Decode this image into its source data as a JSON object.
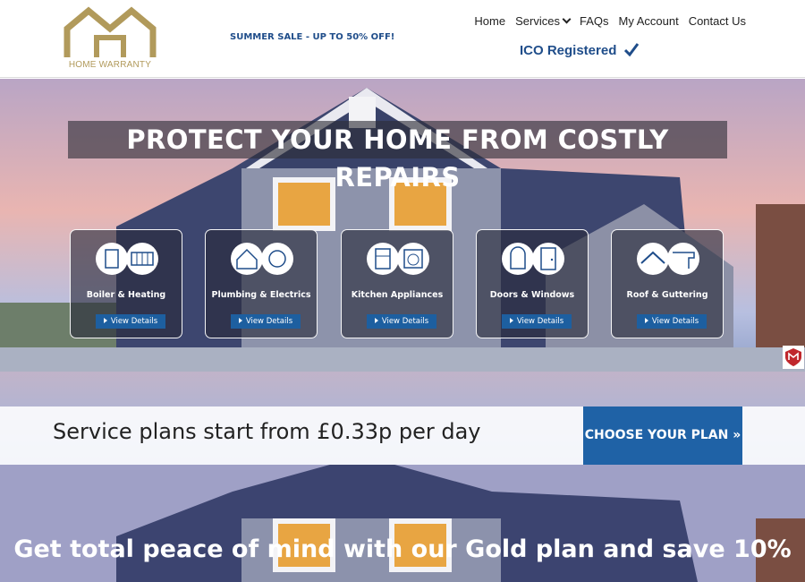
{
  "header": {
    "logo_text": "HOME WARRANTY",
    "promo": "SUMMER SALE - UP TO 50% OFF!",
    "ico": "ICO Registered"
  },
  "nav": {
    "items": [
      {
        "label": "Home"
      },
      {
        "label": "Services"
      },
      {
        "label": "FAQs"
      },
      {
        "label": "My Account"
      },
      {
        "label": "Contact Us"
      }
    ]
  },
  "hero": {
    "headline": "PROTECT YOUR HOME FROM COSTLY REPAIRS"
  },
  "services": [
    {
      "title": "Boiler & Heating",
      "button": "View Details",
      "icons": [
        "boiler-icon",
        "radiator-icon"
      ]
    },
    {
      "title": "Plumbing & Electrics",
      "button": "View Details",
      "icons": [
        "house-plug-icon",
        "fuse-icon"
      ]
    },
    {
      "title": "Kitchen Appliances",
      "button": "View Details",
      "icons": [
        "fridge-icon",
        "washing-machine-icon"
      ]
    },
    {
      "title": "Doors & Windows",
      "button": "View Details",
      "icons": [
        "window-icon",
        "door-icon"
      ]
    },
    {
      "title": "Roof & Guttering",
      "button": "View Details",
      "icons": [
        "roof-icon",
        "gutter-icon"
      ]
    }
  ],
  "plan": {
    "text": "Service plans start from £0.33p per day",
    "button": "CHOOSE YOUR PLAN »"
  },
  "gold": {
    "text": "Get total peace of mind with our Gold plan and save 10%"
  },
  "colors": {
    "brand_gold": "#b19a5b",
    "brand_blue": "#1f62a6",
    "nav_text": "#222222"
  }
}
